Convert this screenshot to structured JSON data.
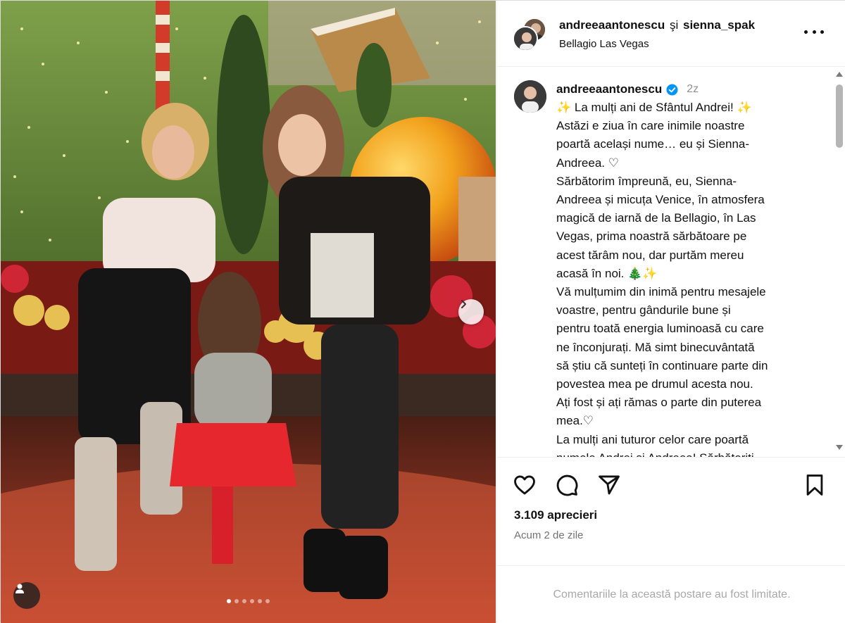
{
  "header": {
    "user1": "andreeaantonescu",
    "conjunction": "şi",
    "user2": "sienna_spak",
    "location": "Bellagio Las Vegas"
  },
  "caption": {
    "username": "andreeaantonescu",
    "time": "2z",
    "lines": [
      "✨ La mulți ani de Sfântul Andrei! ✨",
      "Astăzi e ziua în care inimile noastre",
      "poartă același nume… eu și Sienna-",
      "Andreea. ♡",
      "Sărbătorim împreună, eu, Sienna-",
      "Andreea și micuța Venice, în atmosfera",
      "magică de iarnă de la Bellagio, în Las",
      "Vegas, prima noastră sărbătoare pe",
      "acest tărâm nou, dar purtăm mereu",
      "acasă în noi. 🎄✨",
      "Vă mulțumim din inimă pentru mesajele",
      "voastre, pentru gândurile bune și",
      "pentru toată energia luminoasă cu care",
      "ne înconjurați. Mă simt binecuvântată",
      "să știu că sunteți în continuare parte din",
      "povestea mea pe drumul acesta nou.",
      "Ați fost și ați rămas o parte din puterea",
      "mea.♡",
      "La mulți ani tuturor celor care poartă",
      "numele Andrei și Andreea! Sărbătoriți"
    ]
  },
  "stats": {
    "likes": "3.109 aprecieri",
    "posted": "Acum 2 de zile"
  },
  "footer": {
    "comments_limited": "Comentariile la această postare au fost limitate."
  },
  "carousel": {
    "slides": 6,
    "active_index": 0
  },
  "icons": {
    "more": "more-options-icon",
    "verified": "verified-badge-icon",
    "like": "heart-icon",
    "comment": "comment-icon",
    "share": "share-icon",
    "save": "bookmark-icon",
    "next": "chevron-right-icon",
    "tag": "user-tag-icon"
  },
  "colors": {
    "verified": "#0095f6",
    "muted": "#737373",
    "limited": "#a8a8a8"
  }
}
